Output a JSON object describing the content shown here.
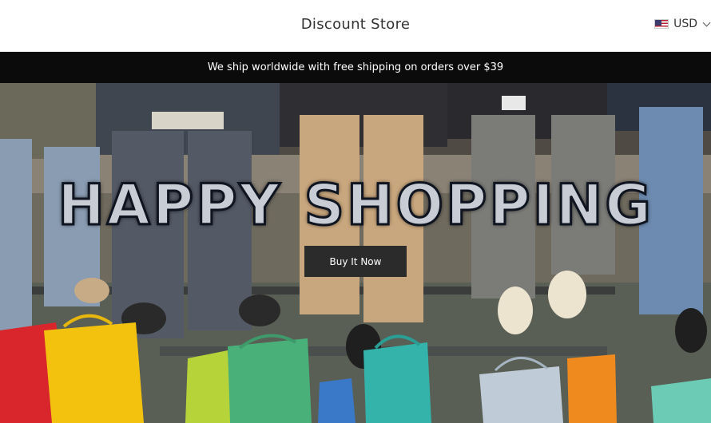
{
  "header": {
    "store_name": "Discount Store",
    "currency": "USD",
    "flag_icon": "us-flag-icon"
  },
  "announcement": {
    "text": "We ship worldwide with free shipping on orders over $39"
  },
  "hero": {
    "headline": "HAPPY SHOPPING",
    "button_label": "Buy It Now"
  },
  "colors": {
    "announcement_bg": "#0b0b0b",
    "button_bg": "#2b2b2b",
    "headline_fill": "#c8ccd4"
  }
}
